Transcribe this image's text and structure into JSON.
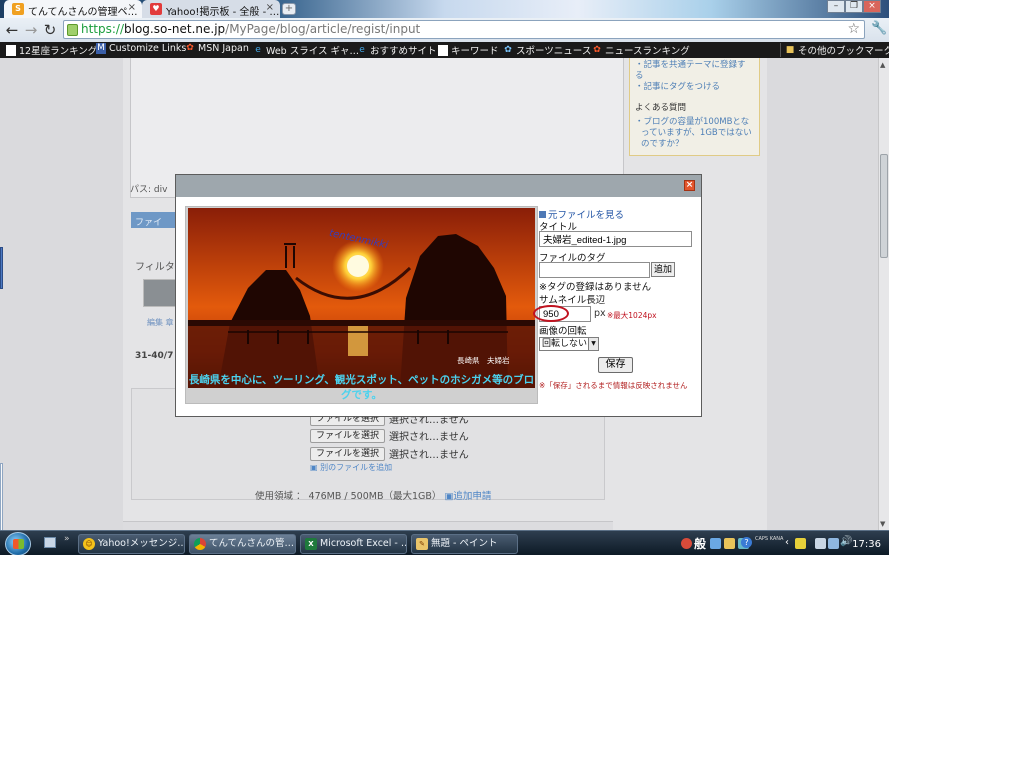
{
  "browser": {
    "tabs": [
      {
        "label": "てんてんさんの管理ペ…",
        "icon": "so-net-s-icon"
      },
      {
        "label": "Yahoo!掲示板 - 全般 - …",
        "icon": "yahoo-heart-icon"
      }
    ],
    "url": {
      "scheme": "https://",
      "host": "blog.so-net.ne.jp",
      "path": "/MyPage/blog/article/regist/input"
    },
    "bookmarks": [
      "12星座ランキング",
      "Customize Links",
      "MSN Japan",
      "Web スライス ギャ…",
      "おすすめサイト",
      "キーワード",
      "スポーツニュース",
      "ニュースランキング"
    ],
    "other_bookmarks": "その他のブックマーク"
  },
  "page": {
    "side_links": [
      "記事を共通テーマに登録する",
      "記事にタグをつける"
    ],
    "faq_heading": "よくある質問",
    "faq_link": "ブログの容量が100MBとなっていますが、1GBではないのですか？",
    "path_label": "パス: div",
    "file_section": "ファイ",
    "filter_label": "フィルタ",
    "edit_label": "編集 章",
    "pager": "31-40/7",
    "file_rows": [
      {
        "button": "ファイルを選択",
        "status": "選択され…ません"
      },
      {
        "button": "ファイルを選択",
        "status": "選択され…ません"
      },
      {
        "button": "ファイルを選択",
        "status": "選択され…ません"
      }
    ],
    "add_file": "別のファイルを追加",
    "usage_text": "使用領域 ： 476MB / 500MB（最大1GB）",
    "usage_link": "追加申請"
  },
  "modal": {
    "photo_overlay": "tentenmikki",
    "photo_place": "長崎県　夫婦岩",
    "photo_caption": "長崎県を中心に、ツーリング、観光スポット、ペットのホシガメ等のブログです。",
    "view_original": "元ファイルを見る",
    "title_label": "タイトル",
    "title_value": "夫婦岩_edited-1.jpg",
    "tag_label": "ファイルのタグ",
    "tag_add": "追加",
    "no_tags": "※タグの登録はありません",
    "thumb_label": "サムネイル長辺",
    "thumb_value": "950",
    "px": "px",
    "max_note": "※最大1024px",
    "rotate_label": "画像の回転",
    "rotate_value": "回転しない",
    "save": "保存",
    "save_note": "※「保存」されるまで情報は反映されません"
  },
  "taskbar": {
    "tasks": [
      {
        "label": "Yahoo!メッセンジ…",
        "icon": "yahoo-messenger-icon"
      },
      {
        "label": "てんてんさんの管…",
        "icon": "chrome-icon"
      },
      {
        "label": "Microsoft Excel - …",
        "icon": "excel-icon"
      },
      {
        "label": "無題 - ペイント",
        "icon": "paint-icon"
      }
    ],
    "tray_text": "般",
    "caps": "CAPS KANA",
    "clock": "17:36"
  }
}
